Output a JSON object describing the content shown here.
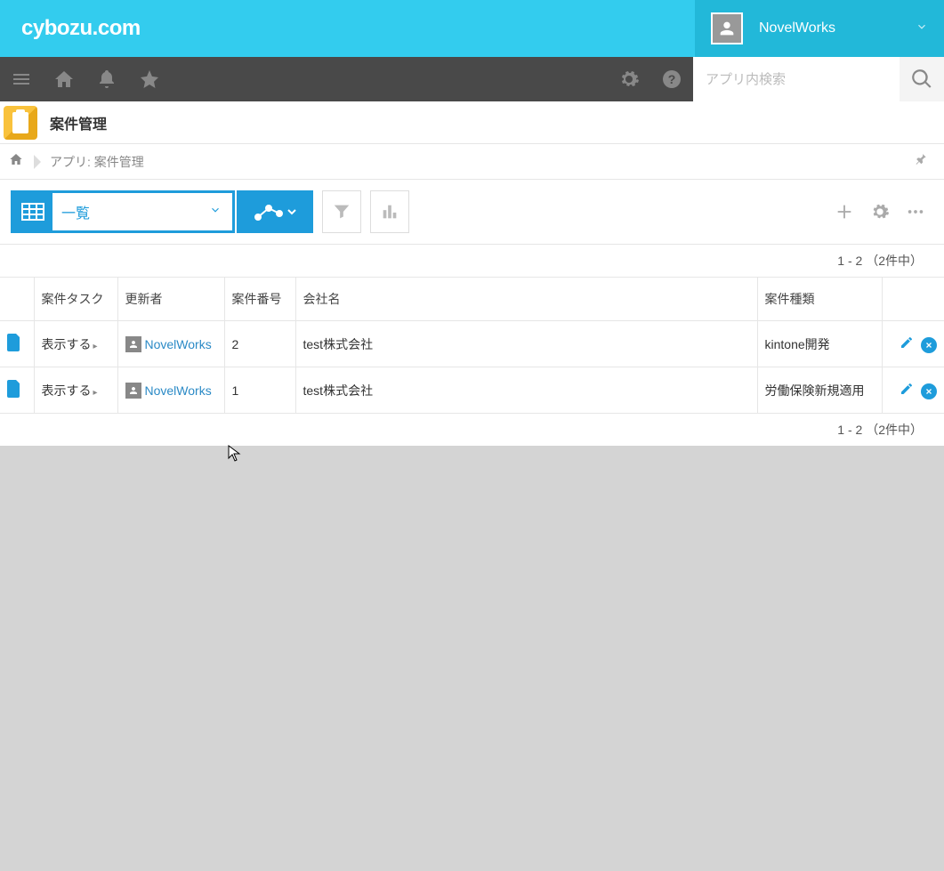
{
  "brand": "cybozu.com",
  "user": {
    "name": "NovelWorks"
  },
  "search": {
    "placeholder": "アプリ内検索"
  },
  "app": {
    "title": "案件管理"
  },
  "breadcrumb": {
    "text": "アプリ: 案件管理"
  },
  "view": {
    "label": "一覧"
  },
  "pager": {
    "text": "1 - 2 （2件中）"
  },
  "columns": {
    "task": "案件タスク",
    "updater": "更新者",
    "number": "案件番号",
    "company": "会社名",
    "type": "案件種類"
  },
  "rows": [
    {
      "show": "表示する",
      "updater": "NovelWorks",
      "number": "2",
      "company": "test株式会社",
      "type": "kintone開発"
    },
    {
      "show": "表示する",
      "updater": "NovelWorks",
      "number": "1",
      "company": "test株式会社",
      "type": "労働保険新規適用"
    }
  ]
}
